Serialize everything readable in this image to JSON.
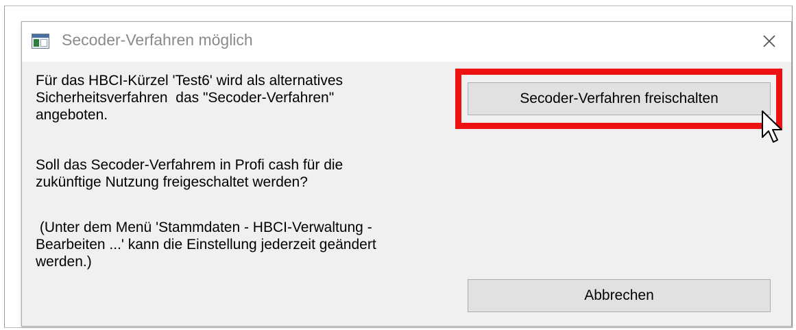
{
  "dialog": {
    "title": "Secoder-Verfahren möglich",
    "icons": {
      "app": "window-app-icon",
      "close": "close-icon",
      "cursor": "mouse-cursor-icon"
    },
    "message": {
      "paragraph1": "Für das HBCI-Kürzel 'Test6' wird als alternatives\nSicherheitsverfahren  das \"Secoder-Verfahren\"\nangeboten.",
      "paragraph2": "Soll das Secoder-Verfahrem in Profi cash für die\nzukünftige Nutzung freigeschaltet werden?",
      "paragraph3": " (Unter dem Menü 'Stammdaten - HBCI-Verwaltung -\nBearbeiten ...' kann die Einstellung jederzeit geändert\nwerden.)"
    },
    "buttons": {
      "unlock_label": "Secoder-Verfahren freischalten",
      "cancel_label": "Abbrechen"
    },
    "highlight_color": "#ee1111"
  }
}
